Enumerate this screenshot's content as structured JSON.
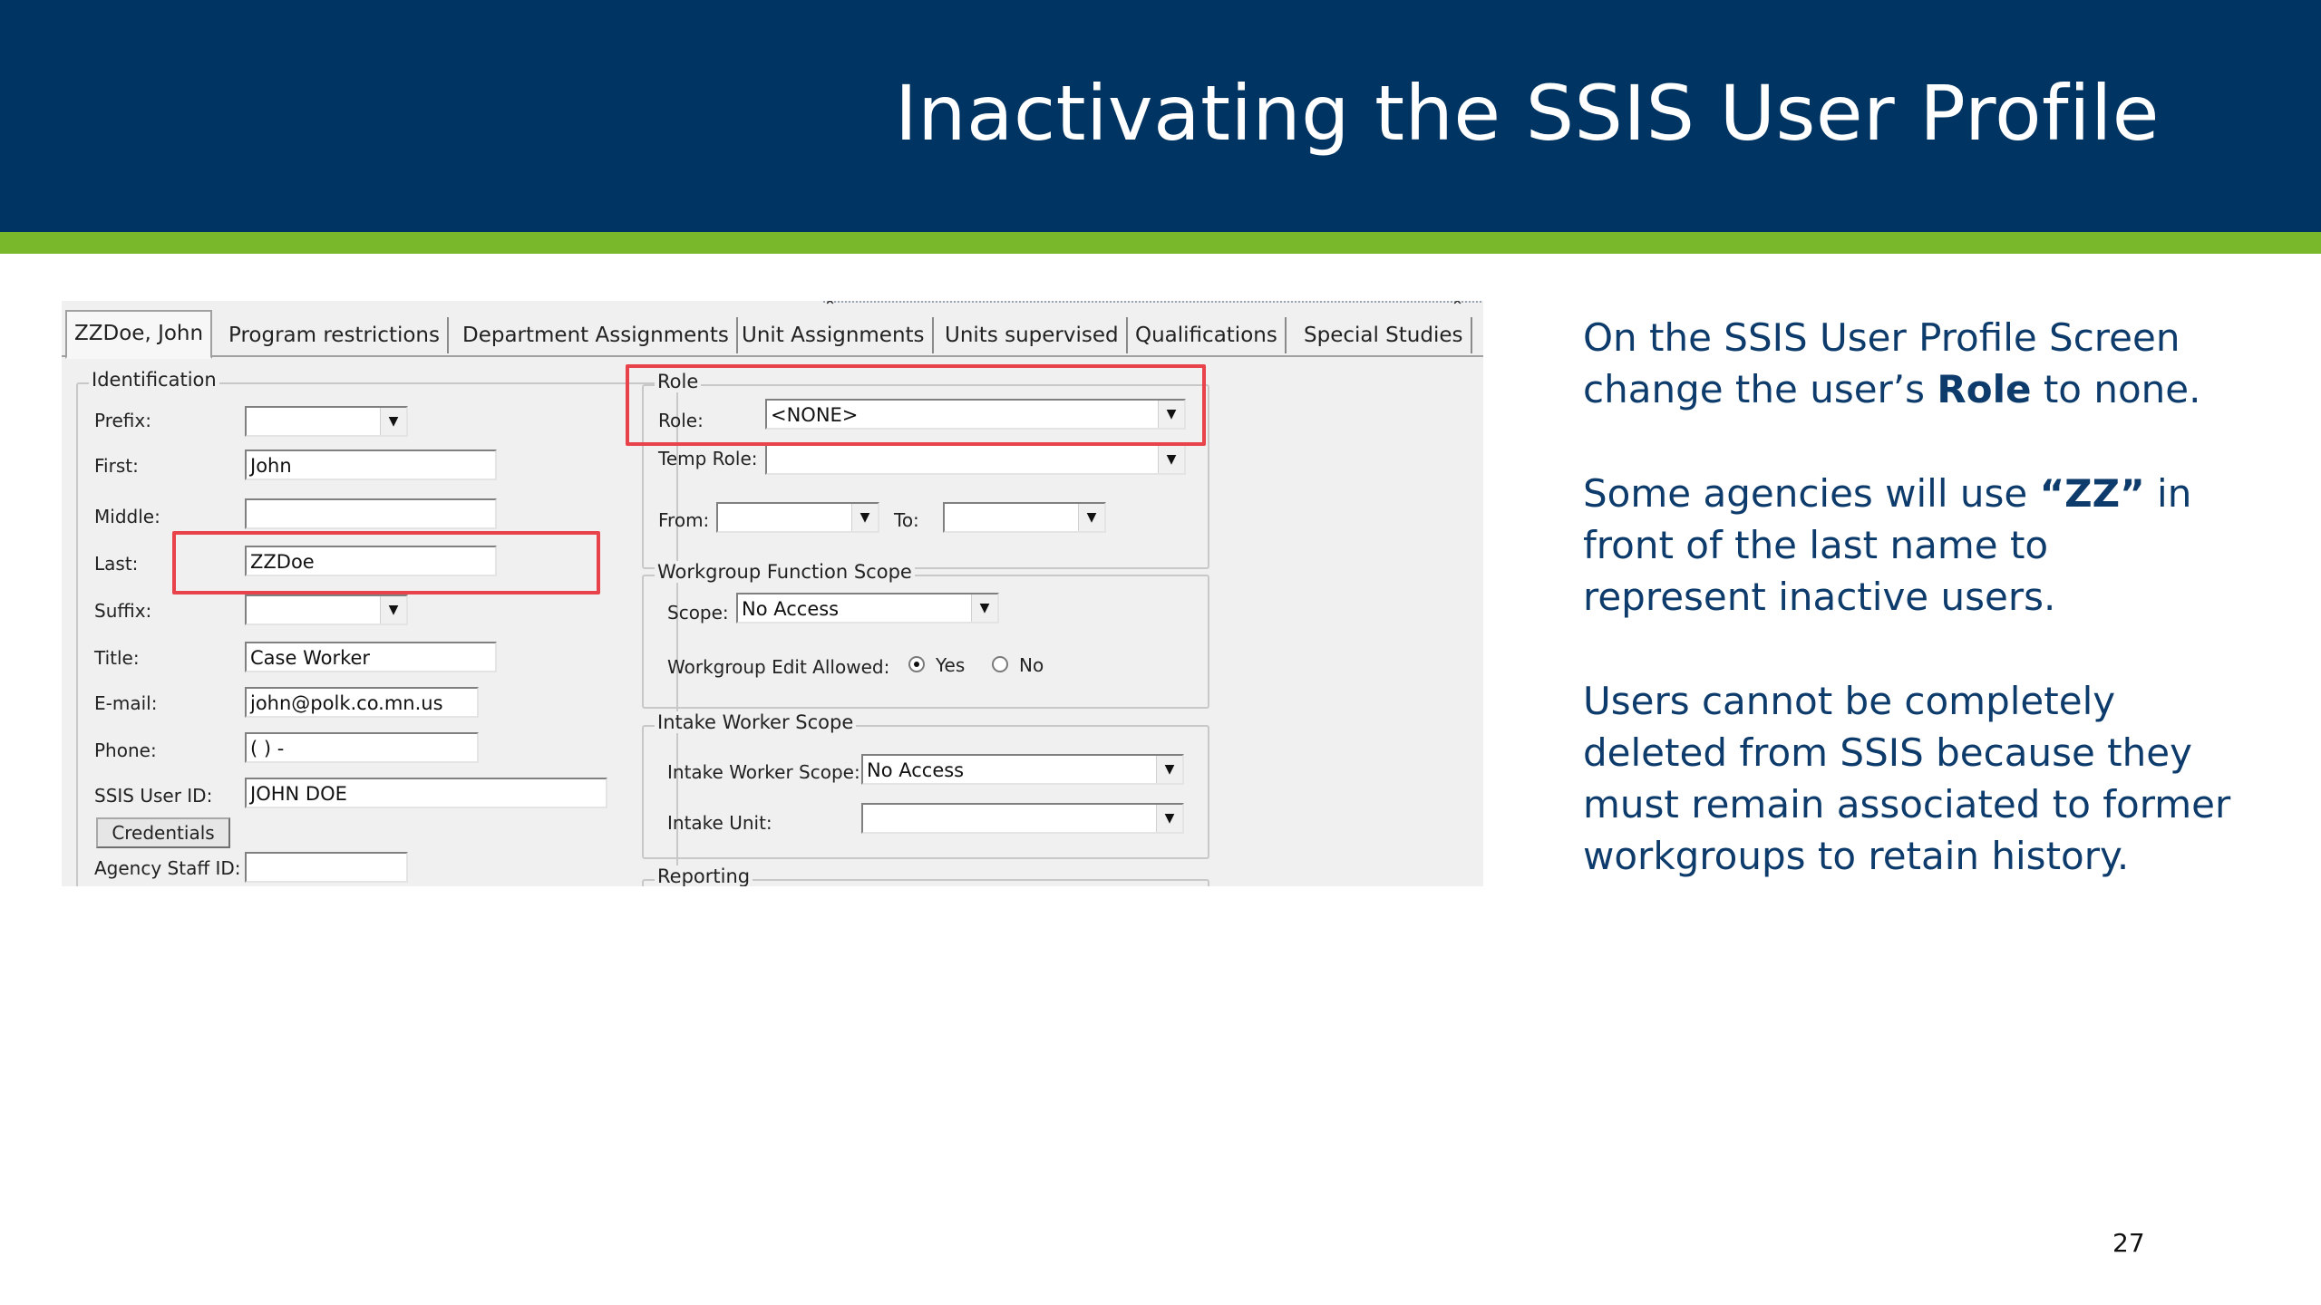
{
  "slide": {
    "title": "Inactivating the SSIS User Profile",
    "page_number": "27",
    "colors": {
      "header": "#003462",
      "accent": "#78b82a",
      "highlight": "#e8434b",
      "text": "#0d3b6b"
    }
  },
  "tabs": [
    {
      "label": "ZZDoe, John",
      "active": true
    },
    {
      "label": "Program restrictions"
    },
    {
      "label": "Department Assignments"
    },
    {
      "label": "Unit Assignments"
    },
    {
      "label": "Units supervised"
    },
    {
      "label": "Qualifications"
    },
    {
      "label": "Special Studies"
    }
  ],
  "identification": {
    "legend": "Identification",
    "prefix_label": "Prefix:",
    "prefix_value": "",
    "first_label": "First:",
    "first_value": "John",
    "middle_label": "Middle:",
    "middle_value": "",
    "last_label": "Last:",
    "last_value": "ZZDoe",
    "suffix_label": "Suffix:",
    "suffix_value": "",
    "title_label": "Title:",
    "title_value": "Case Worker",
    "email_label": "E-mail:",
    "email_value": "john@polk.co.mn.us",
    "phone_label": "Phone:",
    "phone_value": "(  )   -",
    "userid_label": "SSIS User ID:",
    "userid_value": "JOHN DOE",
    "credentials_label": "Credentials",
    "staffid_label": "Agency Staff ID:",
    "staffid_value": ""
  },
  "role": {
    "legend": "Role",
    "role_label": "Role:",
    "role_value": "<NONE>",
    "temp_role_label": "Temp Role:",
    "temp_role_value": "",
    "from_label": "From:",
    "from_value": "",
    "to_label": "To:",
    "to_value": ""
  },
  "workgroup": {
    "legend": "Workgroup Function Scope",
    "scope_label": "Scope:",
    "scope_value": "No Access",
    "edit_label": "Workgroup Edit Allowed:",
    "yes_label": "Yes",
    "no_label": "No",
    "selected": "Yes"
  },
  "intake": {
    "legend": "Intake Worker Scope",
    "scope_label": "Intake Worker Scope:",
    "scope_value": "No Access",
    "unit_label": "Intake Unit:",
    "unit_value": ""
  },
  "reporting": {
    "legend": "Reporting"
  },
  "notes": {
    "p1_pre": "On the SSIS User Profile Screen change the user’s ",
    "p1_bold": "Role",
    "p1_post": " to none.",
    "p2_pre": "Some agencies will use ",
    "p2_bold": "“ZZ”",
    "p2_post": " in front of the last name to represent inactive users.",
    "p3": "Users cannot be completely deleted from SSIS because they must remain associated to former workgroups to retain history."
  }
}
